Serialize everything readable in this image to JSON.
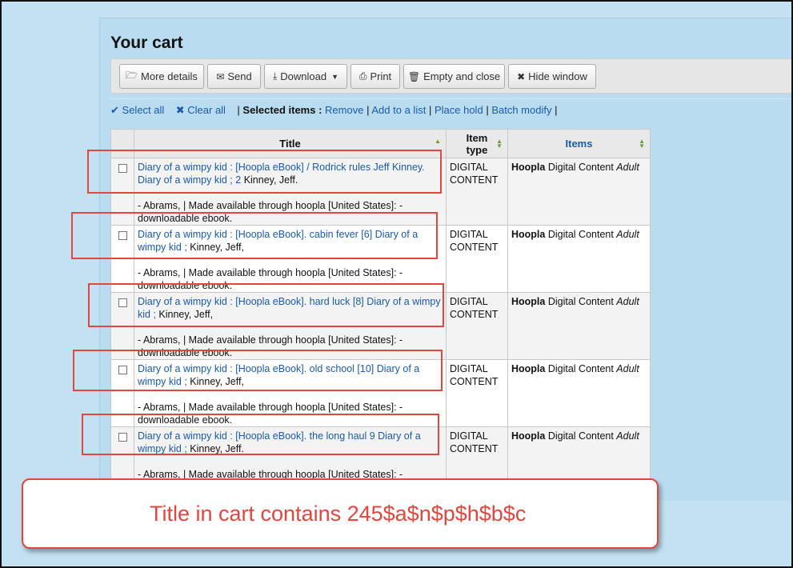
{
  "page": {
    "title": "Your cart"
  },
  "toolbar": {
    "more_details": "More details",
    "send": "Send",
    "download": "Download",
    "print": "Print",
    "empty_close": "Empty and close",
    "hide_window": "Hide window"
  },
  "actions": {
    "select_all": "Select all",
    "clear_all": "Clear all",
    "sep": "|",
    "selected_items": "Selected items :",
    "remove": "Remove",
    "add_to_list": "Add to a list",
    "place_hold": "Place hold",
    "batch_modify": "Batch modify"
  },
  "table": {
    "headers": {
      "title": "Title",
      "item_type": "Item type",
      "items": "Items"
    },
    "rows": [
      {
        "title_link": "Diary of a wimpy kid : [Hoopla eBook] / Rodrick rules Jeff Kinney. Diary of a wimpy kid ; 2",
        "author": " Kinney, Jeff.",
        "publication": "- Abrams, | Made available through hoopla [United States]: - downloadable ebook.",
        "item_type": "DIGITAL CONTENT",
        "items_lib": "Hoopla",
        "items_loc": " Digital Content ",
        "items_coll": "Adult"
      },
      {
        "title_link": "Diary of a wimpy kid : [Hoopla eBook]. cabin fever [6] Diary of a wimpy kid ;",
        "author": " Kinney, Jeff,",
        "publication": "- Abrams, | Made available through hoopla [United States]: - downloadable ebook.",
        "item_type": "DIGITAL CONTENT",
        "items_lib": "Hoopla",
        "items_loc": " Digital Content ",
        "items_coll": "Adult"
      },
      {
        "title_link": "Diary of a wimpy kid : [Hoopla eBook]. hard luck [8] Diary of a wimpy kid ;",
        "author": " Kinney, Jeff,",
        "publication": "- Abrams, | Made available through hoopla [United States]: - downloadable ebook.",
        "item_type": "DIGITAL CONTENT",
        "items_lib": "Hoopla",
        "items_loc": " Digital Content ",
        "items_coll": "Adult"
      },
      {
        "title_link": "Diary of a wimpy kid : [Hoopla eBook]. old school [10] Diary of a wimpy kid ;",
        "author": " Kinney, Jeff,",
        "publication": "- Abrams, | Made available through hoopla [United States]: - downloadable ebook.",
        "item_type": "DIGITAL CONTENT",
        "items_lib": "Hoopla",
        "items_loc": " Digital Content ",
        "items_coll": "Adult"
      },
      {
        "title_link": "Diary of a wimpy kid : [Hoopla eBook]. the long haul 9 Diary of a wimpy kid ;",
        "author": " Kinney, Jeff.",
        "publication": "- Abrams, | Made available through hoopla [United States]: - downloadable ebook.",
        "item_type": "DIGITAL CONTENT",
        "items_lib": "Hoopla",
        "items_loc": " Digital Content ",
        "items_coll": "Adult"
      }
    ]
  },
  "callout": {
    "text": "Title in cart contains 245$a$n$p$h$b$c"
  },
  "colors": {
    "link": "#1a5ba8",
    "highlight": "#e0473f",
    "background": "#c4e1f1"
  }
}
